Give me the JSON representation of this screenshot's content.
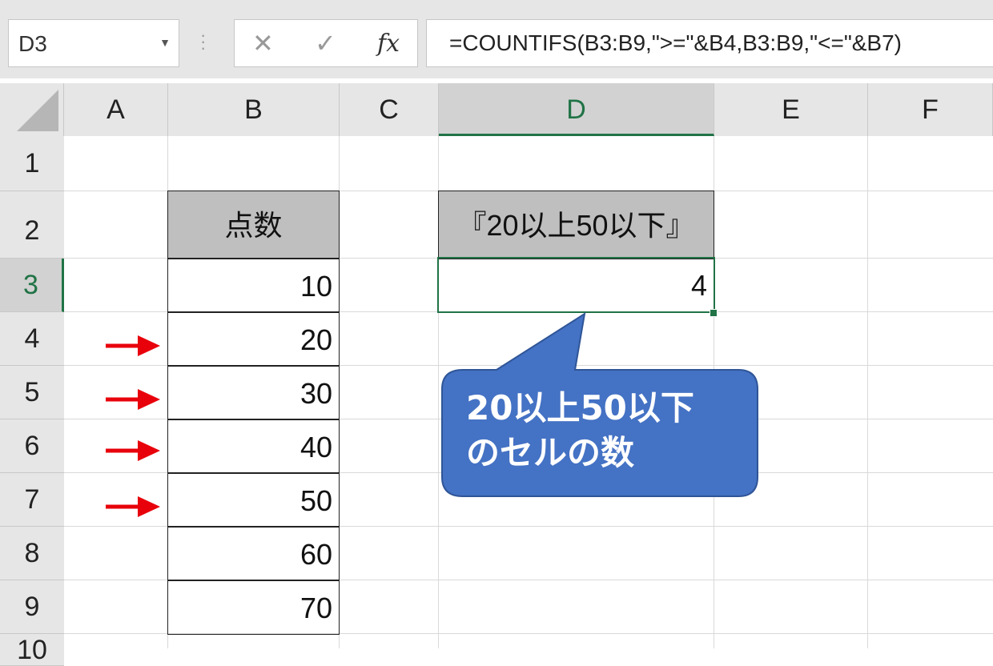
{
  "formula_bar": {
    "name_box": "D3",
    "cancel_symbol": "✕",
    "enter_symbol": "✓",
    "fx_symbol": "fx",
    "formula": "=COUNTIFS(B3:B9,\">=\"&B4,B3:B9,\"<=\"&B7)"
  },
  "columns": [
    "A",
    "B",
    "C",
    "D",
    "E",
    "F"
  ],
  "selected_column": "D",
  "rows": [
    "1",
    "2",
    "3",
    "4",
    "5",
    "6",
    "7",
    "8",
    "9",
    "10"
  ],
  "selected_row": "3",
  "table": {
    "header": "点数",
    "values": [
      "10",
      "20",
      "30",
      "40",
      "50",
      "60",
      "70"
    ]
  },
  "result": {
    "header": "『20以上50以下』",
    "value": "4"
  },
  "arrows_rows": [
    "4",
    "5",
    "6",
    "7"
  ],
  "callout": {
    "line1": "20以上50以下",
    "line2": "のセルの数",
    "color": "#4472c4"
  },
  "colors": {
    "accent": "#217346",
    "arrow": "#e8000b",
    "header_fill": "#bfbfbf"
  }
}
